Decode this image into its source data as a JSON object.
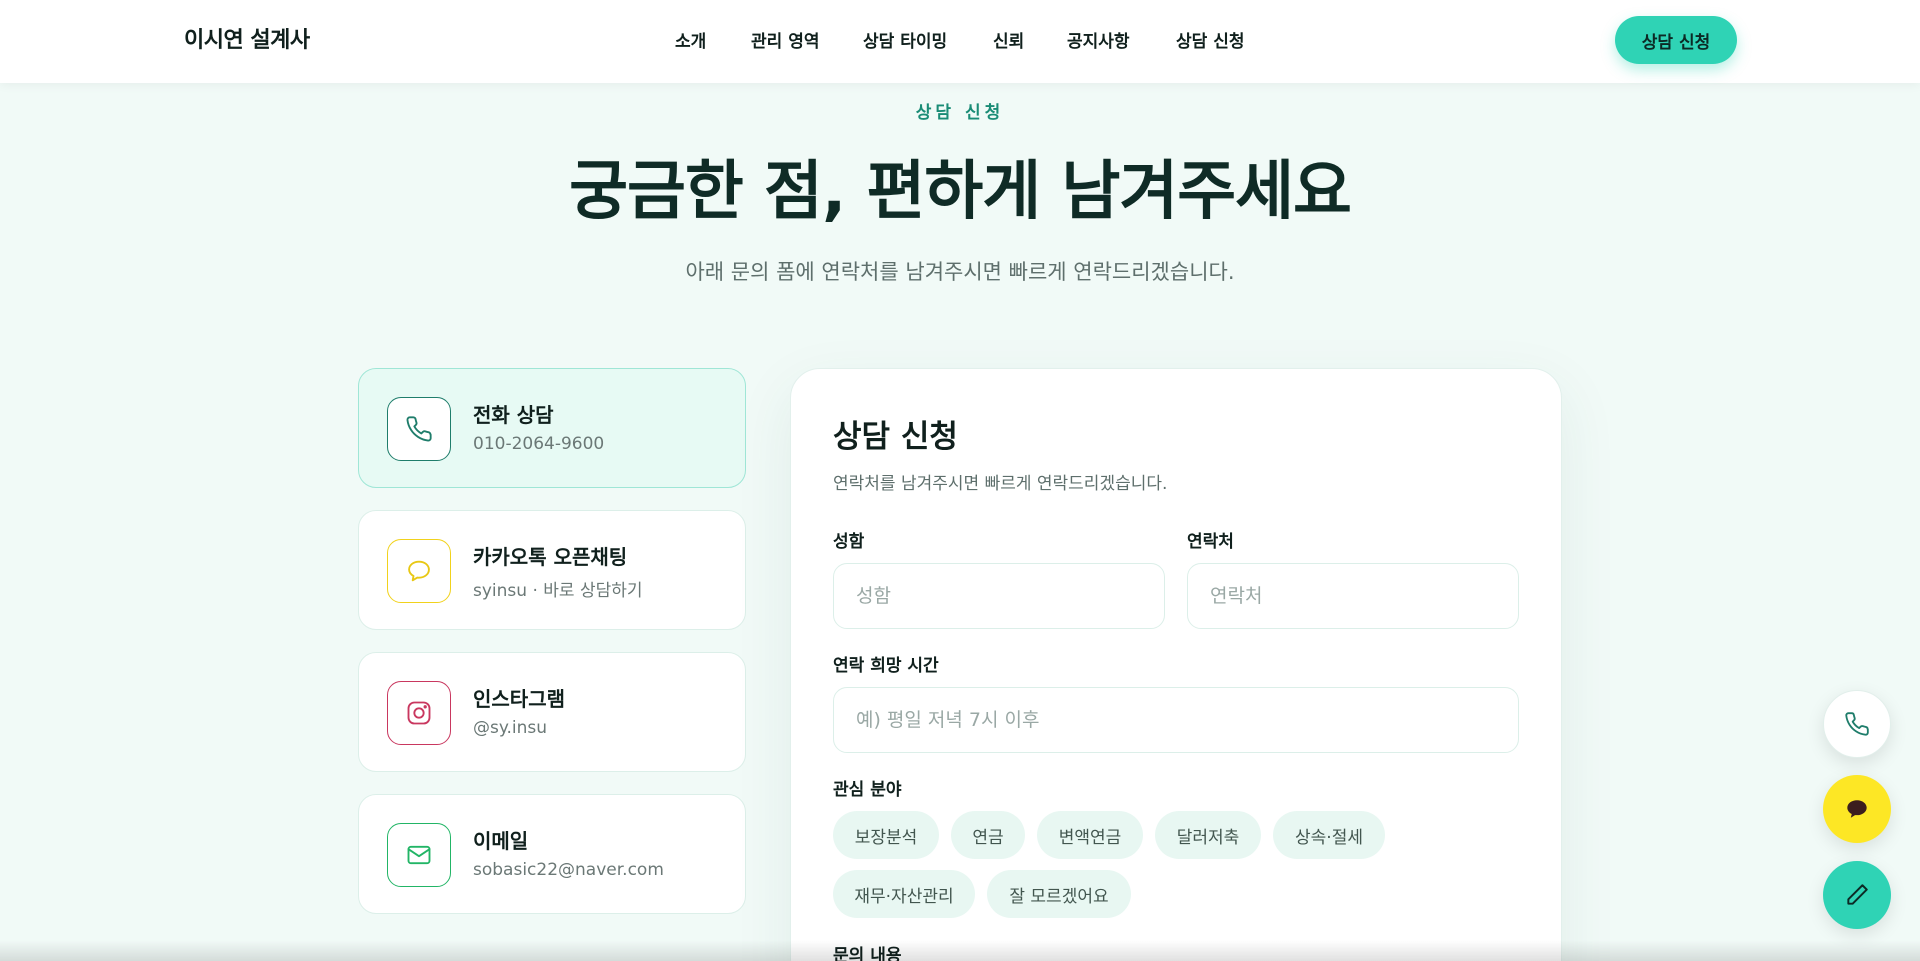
{
  "header": {
    "logo": "이시연 설계사",
    "nav": [
      "소개",
      "관리 영역",
      "상담 타이밍",
      "신뢰",
      "공지사항",
      "상담 신청"
    ],
    "cta_label": "상담 신청"
  },
  "hero": {
    "eyebrow": "상담 신청",
    "title": "궁금한 점, 편하게 남겨주세요",
    "subtitle": "아래 문의 폼에 연락처를 남겨주시면 빠르게 연락드리겠습니다."
  },
  "contacts": [
    {
      "title": "전화 상담",
      "sub": "010-2064-9600",
      "icon": "phone-icon",
      "color": "#1f7d6b"
    },
    {
      "title": "카카오톡 오픈채팅",
      "sub": "syinsu · 바로 상담하기",
      "icon": "chat-bubble-icon",
      "color": "#f1d21c"
    },
    {
      "title": "인스타그램",
      "sub": "@sy.insu",
      "icon": "instagram-icon",
      "color": "#c9375f"
    },
    {
      "title": "이메일",
      "sub": "sobasic22@naver.com",
      "icon": "mail-icon",
      "color": "#22b566"
    }
  ],
  "form": {
    "title": "상담 신청",
    "subtitle": "연락처를 남겨주시면 빠르게 연락드리겠습니다.",
    "name_label": "성함",
    "name_placeholder": "성함",
    "phone_label": "연락처",
    "phone_placeholder": "연락처",
    "time_label": "연락 희망 시간",
    "time_placeholder": "예) 평일 저녁 7시 이후",
    "interest_label": "관심 분야",
    "interests": [
      "보장분석",
      "연금",
      "변액연금",
      "달러저축",
      "상속·절세",
      "재무·자산관리",
      "잘 모르겠어요"
    ],
    "message_label": "문의 내용"
  },
  "colors": {
    "accent": "#2fd3b5",
    "kakao": "#fde725",
    "background": "#f1faf7"
  }
}
